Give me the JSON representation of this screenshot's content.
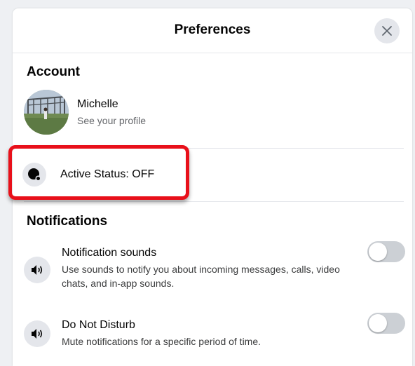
{
  "dialog": {
    "title": "Preferences",
    "close_icon": "close-icon"
  },
  "account": {
    "heading": "Account",
    "profile_name": "Michelle",
    "profile_sub": "See your profile",
    "active_status_label": "Active Status: OFF",
    "active_status_icon": "active-status-icon"
  },
  "notifications": {
    "heading": "Notifications",
    "items": [
      {
        "title": "Notification sounds",
        "description": "Use sounds to notify you about incoming messages, calls, video chats, and in-app sounds.",
        "enabled": false,
        "icon": "speaker-icon"
      },
      {
        "title": "Do Not Disturb",
        "description": "Mute notifications for a specific period of time.",
        "enabled": false,
        "icon": "speaker-icon"
      }
    ]
  },
  "colors": {
    "highlight": "#e8101a",
    "toggle_off": "#ccd0d5",
    "divider": "#e4e6eb"
  }
}
